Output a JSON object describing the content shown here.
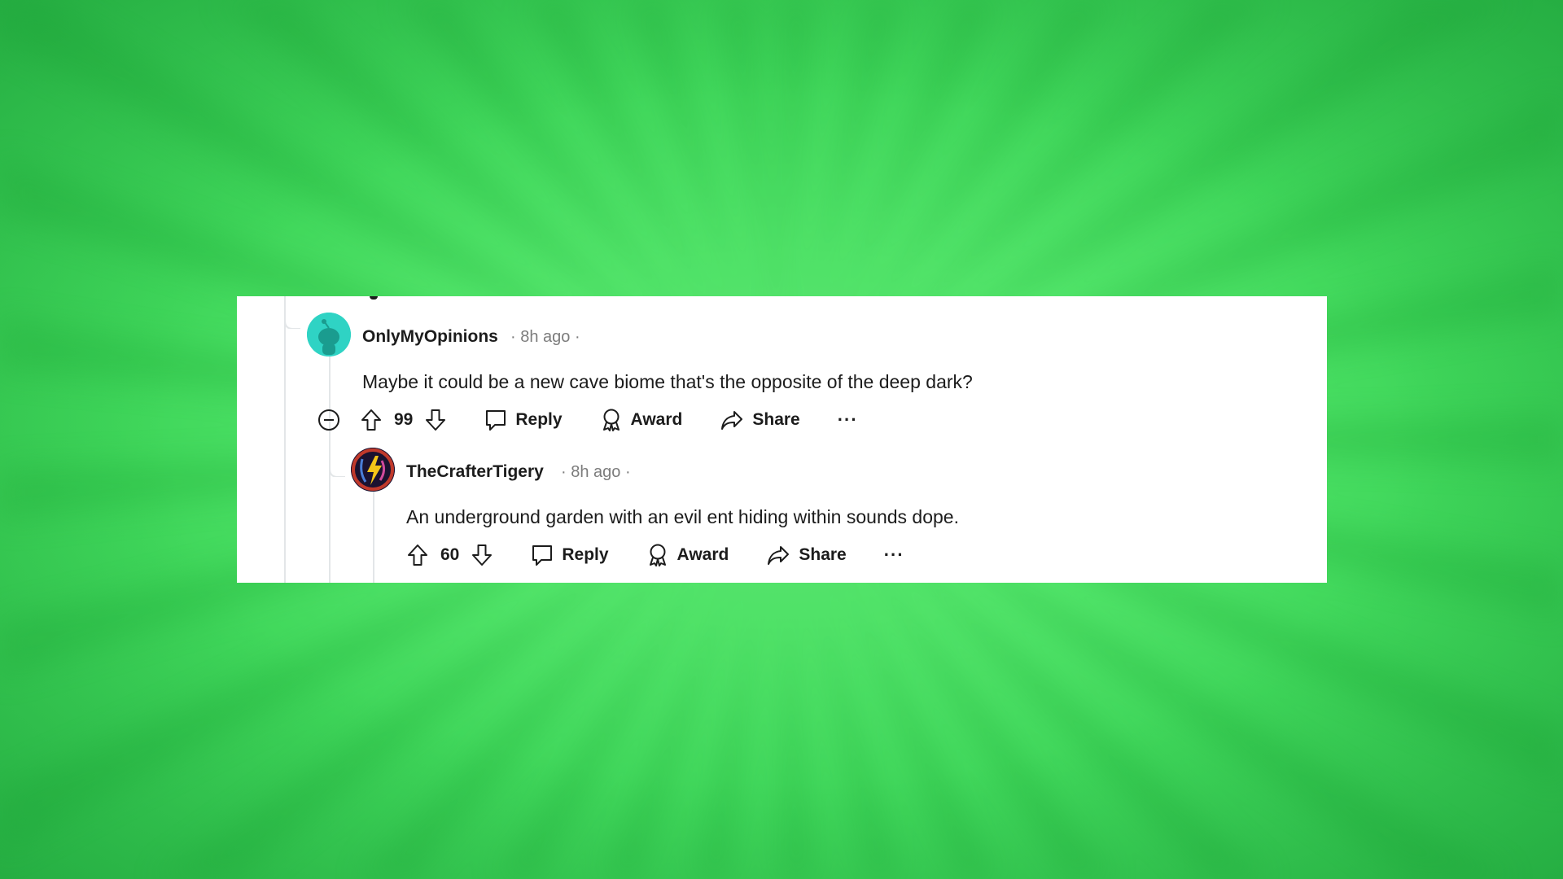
{
  "colors": {
    "background": "#55e86d",
    "card": "#ffffff",
    "text": "#1c1c1c",
    "meta": "#7c7c7c",
    "thread_line": "#e3e6e8",
    "avatar1": "#2fd3c4"
  },
  "comments": [
    {
      "username": "OnlyMyOpinions",
      "meta": "· 8h ago ·",
      "body": "Maybe it could be a new cave biome that's the opposite of the deep dark?",
      "score": "99",
      "actions": {
        "reply": "Reply",
        "award": "Award",
        "share": "Share",
        "more": "···"
      }
    },
    {
      "username": "TheCrafterTigery",
      "meta": "· 8h ago ·",
      "body": "An underground garden with an evil ent hiding within sounds dope.",
      "score": "60",
      "actions": {
        "reply": "Reply",
        "award": "Award",
        "share": "Share",
        "more": "···"
      }
    }
  ]
}
